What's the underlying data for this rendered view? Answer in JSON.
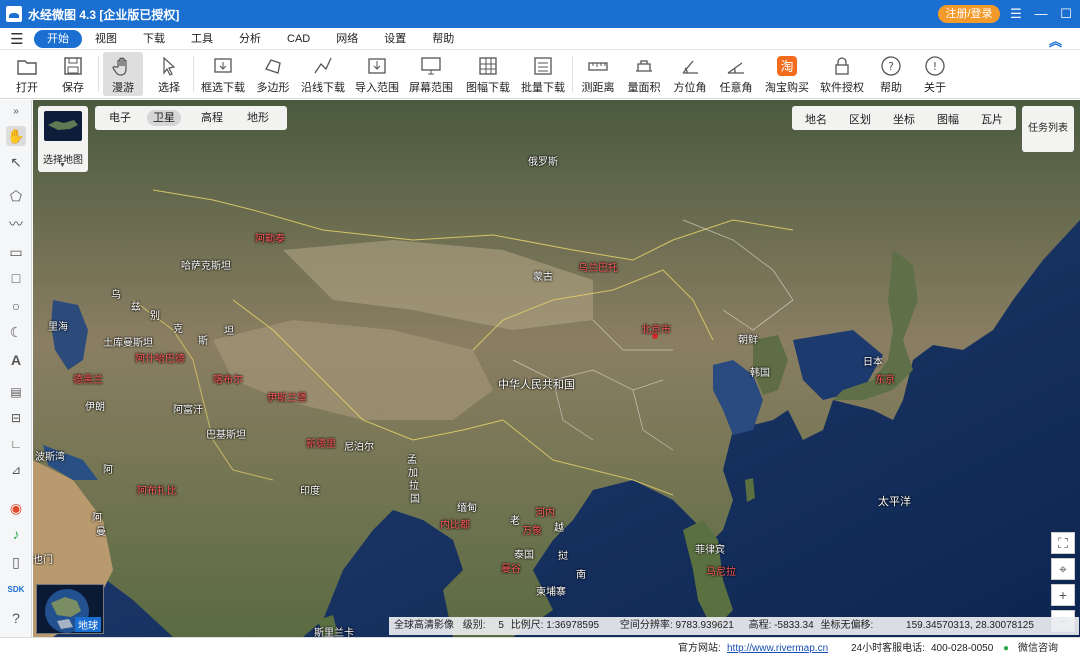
{
  "titlebar": {
    "title": "水经微图 4.3 [企业版已授权]",
    "login": "注册/登录",
    "min_icon": "—",
    "restore_icon": "☐",
    "close_icon": "✕",
    "settings_icon": "☰"
  },
  "menu": {
    "items": [
      "开始",
      "视图",
      "下载",
      "工具",
      "分析",
      "CAD",
      "网络",
      "设置",
      "帮助"
    ],
    "active": "开始"
  },
  "toolbar": {
    "items": [
      "打开",
      "保存",
      "漫游",
      "选择",
      "框选下载",
      "多边形",
      "沿线下载",
      "导入范围",
      "屏幕范围",
      "图幅下载",
      "批量下载",
      "测距离",
      "量面积",
      "方位角",
      "任意角",
      "淘宝购买",
      "软件授权",
      "帮助",
      "关于"
    ],
    "active": "漫游"
  },
  "left_tools": [
    "expand",
    "hand",
    "select",
    "polygon",
    "polyline",
    "rectangle",
    "rectangle-alt",
    "circle",
    "moon",
    "text",
    "ruler",
    "area",
    "angle",
    "arbitrary-angle",
    "layers",
    "note",
    "phone",
    "SDK",
    "help"
  ],
  "map": {
    "select_map_label": "选择地图",
    "types": [
      "电子",
      "卫星",
      "高程",
      "地形"
    ],
    "selected_type": "卫星",
    "layers": [
      "地名",
      "区划",
      "坐标",
      "图幅",
      "瓦片"
    ],
    "task_list": "任务列表",
    "minimap_label": "地球",
    "labels": [
      {
        "text": "俄罗斯",
        "color": "white"
      },
      {
        "text": "阿勒泰",
        "color": "red"
      },
      {
        "text": "哈萨克斯坦",
        "color": "white"
      },
      {
        "text": "蒙古",
        "color": "white"
      },
      {
        "text": "乌兰巴托",
        "color": "red"
      },
      {
        "text": "乌",
        "color": "white"
      },
      {
        "text": "兹",
        "color": "white"
      },
      {
        "text": "别",
        "color": "white"
      },
      {
        "text": "克",
        "color": "white"
      },
      {
        "text": "坦",
        "color": "white"
      },
      {
        "text": "斯",
        "color": "white"
      },
      {
        "text": "里海",
        "color": "white"
      },
      {
        "text": "土库曼斯坦",
        "color": "white"
      },
      {
        "text": "阿什哈巴德",
        "color": "red"
      },
      {
        "text": "德黑兰",
        "color": "red"
      },
      {
        "text": "喀布尔",
        "color": "red"
      },
      {
        "text": "伊朗",
        "color": "white"
      },
      {
        "text": "阿富汗",
        "color": "white"
      },
      {
        "text": "伊斯兰堡",
        "color": "red"
      },
      {
        "text": "巴基斯坦",
        "color": "white"
      },
      {
        "text": "新德里",
        "color": "red"
      },
      {
        "text": "尼泊尔",
        "color": "white"
      },
      {
        "text": "印度",
        "color": "white"
      },
      {
        "text": "中华人民共和国",
        "color": "white"
      },
      {
        "text": "北京市",
        "color": "red"
      },
      {
        "text": "朝鲜",
        "color": "white"
      },
      {
        "text": "韩国",
        "color": "white"
      },
      {
        "text": "日本",
        "color": "white"
      },
      {
        "text": "东京",
        "color": "red"
      },
      {
        "text": "孟",
        "color": "white"
      },
      {
        "text": "加",
        "color": "white"
      },
      {
        "text": "拉",
        "color": "white"
      },
      {
        "text": "国",
        "color": "white"
      },
      {
        "text": "缅甸",
        "color": "white"
      },
      {
        "text": "内比都",
        "color": "red"
      },
      {
        "text": "河内",
        "color": "red"
      },
      {
        "text": "万象",
        "color": "red"
      },
      {
        "text": "老",
        "color": "white"
      },
      {
        "text": "越",
        "color": "white"
      },
      {
        "text": "泰国",
        "color": "white"
      },
      {
        "text": "挝",
        "color": "white"
      },
      {
        "text": "曼谷",
        "color": "red"
      },
      {
        "text": "柬埔寨",
        "color": "white"
      },
      {
        "text": "南",
        "color": "white"
      },
      {
        "text": "菲律宾",
        "color": "white"
      },
      {
        "text": "马尼拉",
        "color": "red"
      },
      {
        "text": "太平洋",
        "color": "white"
      },
      {
        "text": "斯里兰卡",
        "color": "white"
      },
      {
        "text": "波斯湾",
        "color": "white"
      },
      {
        "text": "阿",
        "color": "white"
      },
      {
        "text": "阿布扎比",
        "color": "red"
      },
      {
        "text": "阿",
        "color": "white"
      },
      {
        "text": "曼",
        "color": "white"
      },
      {
        "text": "也门",
        "color": "white"
      }
    ]
  },
  "status": {
    "imagery": "全球高清影像",
    "level_label": "级别:",
    "level": "5",
    "scale_label": "比例尺:",
    "scale": "1:36978595",
    "resolution_label": "空间分辨率:",
    "resolution": "9783.939621",
    "elevation_label": "高程:",
    "elevation": "-5833.34",
    "offset_label": "坐标无偏移:",
    "coords": "159.34570313, 28.30078125"
  },
  "footer": {
    "website_label": "官方网站:",
    "website": "http://www.rivermap.cn",
    "hotline_label": "24小时客服电话:",
    "hotline": "400-028-0050",
    "wechat": "微信咨询"
  },
  "colors": {
    "accent": "#1a6fd1",
    "login": "#f39a2b",
    "label_red": "#ff5a5a"
  }
}
